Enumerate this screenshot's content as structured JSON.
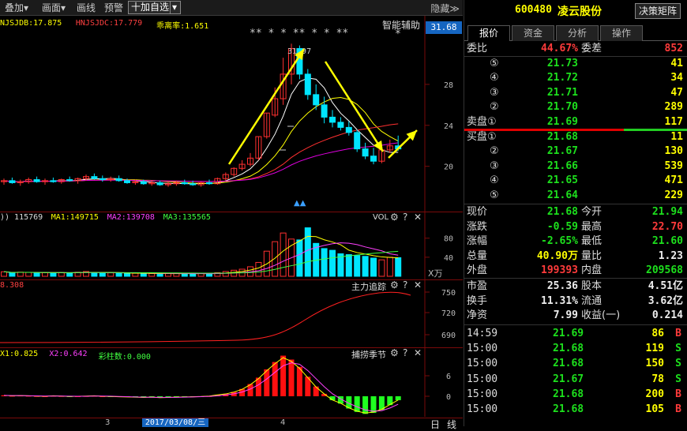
{
  "toolbar": {
    "overlay": "叠加▾",
    "draw": "画面▾",
    "line": "画线",
    "alert": "预警",
    "add_watch": "十加自选",
    "dropdown": "▾",
    "hide": "隐藏≫"
  },
  "kline": {
    "ind_labels": [
      {
        "text": "NJSJDB:17.875",
        "color": "#ffff00"
      },
      {
        "text": "HNJSJDC:17.779",
        "color": "#ff4040"
      },
      {
        "text": "乖离率:1.651",
        "color": "#ffff00"
      }
    ],
    "assist": "智能辅助",
    "price_tag": "31.68",
    "ticks": [
      "28",
      "24",
      "20"
    ],
    "annot_stars": "** * * ** * * **",
    "annot_star2": "*",
    "annot_high": "31.97",
    "annot_low": "▲▲",
    "candles": [
      {
        "o": 18.5,
        "h": 18.8,
        "l": 18.2,
        "c": 18.6
      },
      {
        "o": 18.6,
        "h": 18.9,
        "l": 18.3,
        "c": 18.4
      },
      {
        "o": 18.4,
        "h": 18.7,
        "l": 18.1,
        "c": 18.5
      },
      {
        "o": 18.5,
        "h": 18.9,
        "l": 18.3,
        "c": 18.7
      },
      {
        "o": 18.7,
        "h": 19.0,
        "l": 18.4,
        "c": 18.5
      },
      {
        "o": 18.5,
        "h": 18.8,
        "l": 18.2,
        "c": 18.6
      },
      {
        "o": 18.6,
        "h": 18.9,
        "l": 18.4,
        "c": 18.5
      },
      {
        "o": 18.5,
        "h": 18.8,
        "l": 18.3,
        "c": 18.7
      },
      {
        "o": 18.7,
        "h": 19.0,
        "l": 18.5,
        "c": 18.6
      },
      {
        "o": 18.6,
        "h": 18.9,
        "l": 18.3,
        "c": 18.8
      },
      {
        "o": 18.8,
        "h": 19.2,
        "l": 18.6,
        "c": 19.0
      },
      {
        "o": 19.0,
        "h": 19.3,
        "l": 18.7,
        "c": 18.8
      },
      {
        "o": 18.8,
        "h": 19.1,
        "l": 18.5,
        "c": 18.7
      },
      {
        "o": 18.7,
        "h": 19.0,
        "l": 18.5,
        "c": 18.8
      },
      {
        "o": 18.8,
        "h": 19.1,
        "l": 18.5,
        "c": 18.6
      },
      {
        "o": 18.6,
        "h": 18.8,
        "l": 18.3,
        "c": 18.4
      },
      {
        "o": 18.4,
        "h": 18.7,
        "l": 18.2,
        "c": 18.5
      },
      {
        "o": 18.5,
        "h": 18.7,
        "l": 18.2,
        "c": 18.3
      },
      {
        "o": 18.3,
        "h": 18.6,
        "l": 18.1,
        "c": 18.4
      },
      {
        "o": 18.4,
        "h": 18.6,
        "l": 18.1,
        "c": 18.2
      },
      {
        "o": 18.2,
        "h": 18.5,
        "l": 18.0,
        "c": 18.3
      },
      {
        "o": 18.3,
        "h": 18.6,
        "l": 18.1,
        "c": 18.4
      },
      {
        "o": 18.4,
        "h": 18.7,
        "l": 18.2,
        "c": 18.3
      },
      {
        "o": 18.3,
        "h": 18.6,
        "l": 18.1,
        "c": 18.2
      },
      {
        "o": 18.2,
        "h": 18.5,
        "l": 18.0,
        "c": 18.4
      },
      {
        "o": 18.4,
        "h": 18.7,
        "l": 18.2,
        "c": 18.3
      },
      {
        "o": 18.3,
        "h": 18.9,
        "l": 18.2,
        "c": 18.8
      },
      {
        "o": 18.8,
        "h": 19.4,
        "l": 18.6,
        "c": 19.2
      },
      {
        "o": 19.2,
        "h": 19.9,
        "l": 19.0,
        "c": 19.8
      },
      {
        "o": 19.8,
        "h": 20.6,
        "l": 19.6,
        "c": 20.2
      },
      {
        "o": 20.2,
        "h": 21.3,
        "l": 20.0,
        "c": 20.8
      },
      {
        "o": 20.8,
        "h": 22.9,
        "l": 20.6,
        "c": 22.9
      },
      {
        "o": 22.9,
        "h": 25.2,
        "l": 22.7,
        "c": 25.2
      },
      {
        "o": 25.0,
        "h": 27.7,
        "l": 24.8,
        "c": 26.6
      },
      {
        "o": 26.6,
        "h": 30.6,
        "l": 26.0,
        "c": 29.0
      },
      {
        "o": 29.0,
        "h": 31.97,
        "l": 28.0,
        "c": 31.5
      },
      {
        "o": 31.5,
        "h": 31.8,
        "l": 28.5,
        "c": 29.0
      },
      {
        "o": 29.0,
        "h": 29.5,
        "l": 26.5,
        "c": 27.0
      },
      {
        "o": 27.0,
        "h": 28.0,
        "l": 25.5,
        "c": 26.0
      },
      {
        "o": 26.0,
        "h": 26.8,
        "l": 24.2,
        "c": 24.8
      },
      {
        "o": 24.8,
        "h": 25.5,
        "l": 23.8,
        "c": 24.3
      },
      {
        "o": 24.3,
        "h": 24.8,
        "l": 23.5,
        "c": 23.8
      },
      {
        "o": 23.8,
        "h": 24.4,
        "l": 23.0,
        "c": 23.3
      },
      {
        "o": 23.3,
        "h": 23.6,
        "l": 21.4,
        "c": 21.7
      },
      {
        "o": 21.7,
        "h": 22.3,
        "l": 20.7,
        "c": 21.0
      },
      {
        "o": 21.0,
        "h": 21.8,
        "l": 20.2,
        "c": 20.5
      },
      {
        "o": 20.5,
        "h": 21.9,
        "l": 20.3,
        "c": 21.6
      },
      {
        "o": 21.6,
        "h": 22.6,
        "l": 21.3,
        "c": 22.0
      },
      {
        "o": 22.0,
        "h": 23.0,
        "l": 21.5,
        "c": 21.7
      }
    ]
  },
  "vol": {
    "header": [
      {
        "text": ")) 115769",
        "color": "#dddddd"
      },
      {
        "text": "MA1:149715",
        "color": "#ffff00"
      },
      {
        "text": "MA2:139708",
        "color": "#ff40ff"
      },
      {
        "text": "MA3:135565",
        "color": "#40ff40"
      }
    ],
    "title": "VOL",
    "ticks": [
      "80",
      "40"
    ],
    "unit": "X万",
    "bars": [
      52,
      38,
      48,
      45,
      40,
      42,
      36,
      44,
      39,
      47,
      55,
      41,
      38,
      40,
      37,
      33,
      35,
      30,
      32,
      29,
      31,
      34,
      30,
      28,
      33,
      29,
      42,
      55,
      70,
      82,
      110,
      160,
      290,
      400,
      500,
      430,
      420,
      560,
      380,
      320,
      300,
      260,
      250,
      240,
      230,
      210,
      190,
      220,
      215
    ]
  },
  "zl": {
    "header": "8.308",
    "title": "主力追踪",
    "ticks": [
      "750",
      "720",
      "690"
    ]
  },
  "bc": {
    "header": [
      {
        "text": "X1:0.825",
        "color": "#ffff00"
      },
      {
        "text": "X2:0.642",
        "color": "#ff40ff"
      },
      {
        "text": "彩柱数:0.000",
        "color": "#40ff40"
      }
    ],
    "title": "捕捞季节",
    "ticks": [
      "6",
      "0"
    ],
    "bars": [
      0.2,
      0.1,
      0.15,
      0.1,
      0.05,
      0,
      0.1,
      0.05,
      -0.05,
      0,
      0.05,
      0.1,
      0,
      -0.05,
      -0.1,
      -0.15,
      -0.2,
      -0.25,
      -0.2,
      -0.3,
      -0.25,
      -0.2,
      -0.15,
      -0.1,
      -0.05,
      0.05,
      0.3,
      0.5,
      0.9,
      1.5,
      2.5,
      3.8,
      5.5,
      7.0,
      8.3,
      7.5,
      6.0,
      4.0,
      2.0,
      0.5,
      -0.8,
      -1.5,
      -2.5,
      -3.2,
      -3.6,
      -3.4,
      -2.8,
      -1.8,
      -0.8
    ]
  },
  "xaxis": {
    "m3": "3",
    "date": "2017/03/08/三",
    "m4": "4",
    "day": "日",
    "line": "线"
  },
  "quote": {
    "code": "600480",
    "name": "凌云股份",
    "btn": "决策矩阵",
    "tabs": [
      "报价",
      "资金",
      "分析",
      "操作"
    ],
    "ratio": {
      "l": "委比",
      "v": "44.67%",
      "l2": "委差",
      "v2": "852"
    },
    "sells": [
      {
        "l": "⑤",
        "p": "21.73",
        "v": "41"
      },
      {
        "l": "④",
        "p": "21.72",
        "v": "34"
      },
      {
        "l": "③",
        "p": "21.71",
        "v": "47"
      },
      {
        "l": "②",
        "p": "21.70",
        "v": "289"
      },
      {
        "l": "卖盘①",
        "p": "21.69",
        "v": "117"
      }
    ],
    "buys": [
      {
        "l": "买盘①",
        "p": "21.68",
        "v": "11"
      },
      {
        "l": "②",
        "p": "21.67",
        "v": "130"
      },
      {
        "l": "③",
        "p": "21.66",
        "v": "539"
      },
      {
        "l": "④",
        "p": "21.65",
        "v": "471"
      },
      {
        "l": "⑤",
        "p": "21.64",
        "v": "229"
      }
    ],
    "stats": [
      {
        "l": "现价",
        "v": "21.68",
        "c": "grn",
        "l2": "今开",
        "v2": "21.94",
        "c2": "grn"
      },
      {
        "l": "涨跌",
        "v": "-0.59",
        "c": "grn",
        "l2": "最高",
        "v2": "22.70",
        "c2": "red"
      },
      {
        "l": "涨幅",
        "v": "-2.65%",
        "c": "grn",
        "l2": "最低",
        "v2": "21.60",
        "c2": "grn"
      },
      {
        "l": "总量",
        "v": "40.90万",
        "c": "yel",
        "l2": "量比",
        "v2": "1.23",
        "c2": "wht"
      },
      {
        "l": "外盘",
        "v": "199393",
        "c": "red",
        "l2": "内盘",
        "v2": "209568",
        "c2": "grn"
      }
    ],
    "fund": [
      {
        "l": "市盈",
        "v": "25.36",
        "l2": "股本",
        "v2": "4.51亿"
      },
      {
        "l": "换手",
        "v": "11.31%",
        "l2": "流通",
        "v2": "3.62亿"
      },
      {
        "l": "净资",
        "v": "7.99",
        "l2": "收益(一)",
        "v2": "0.214"
      }
    ],
    "ticks": [
      {
        "t": "14:59",
        "p": "21.69",
        "v": "86",
        "s": "B"
      },
      {
        "t": "15:00",
        "p": "21.68",
        "v": "119",
        "s": "S"
      },
      {
        "t": "15:00",
        "p": "21.68",
        "v": "150",
        "s": "S"
      },
      {
        "t": "15:00",
        "p": "21.67",
        "v": "78",
        "s": "S"
      },
      {
        "t": "15:00",
        "p": "21.68",
        "v": "200",
        "s": "B"
      },
      {
        "t": "15:00",
        "p": "21.68",
        "v": "105",
        "s": "B"
      }
    ]
  }
}
